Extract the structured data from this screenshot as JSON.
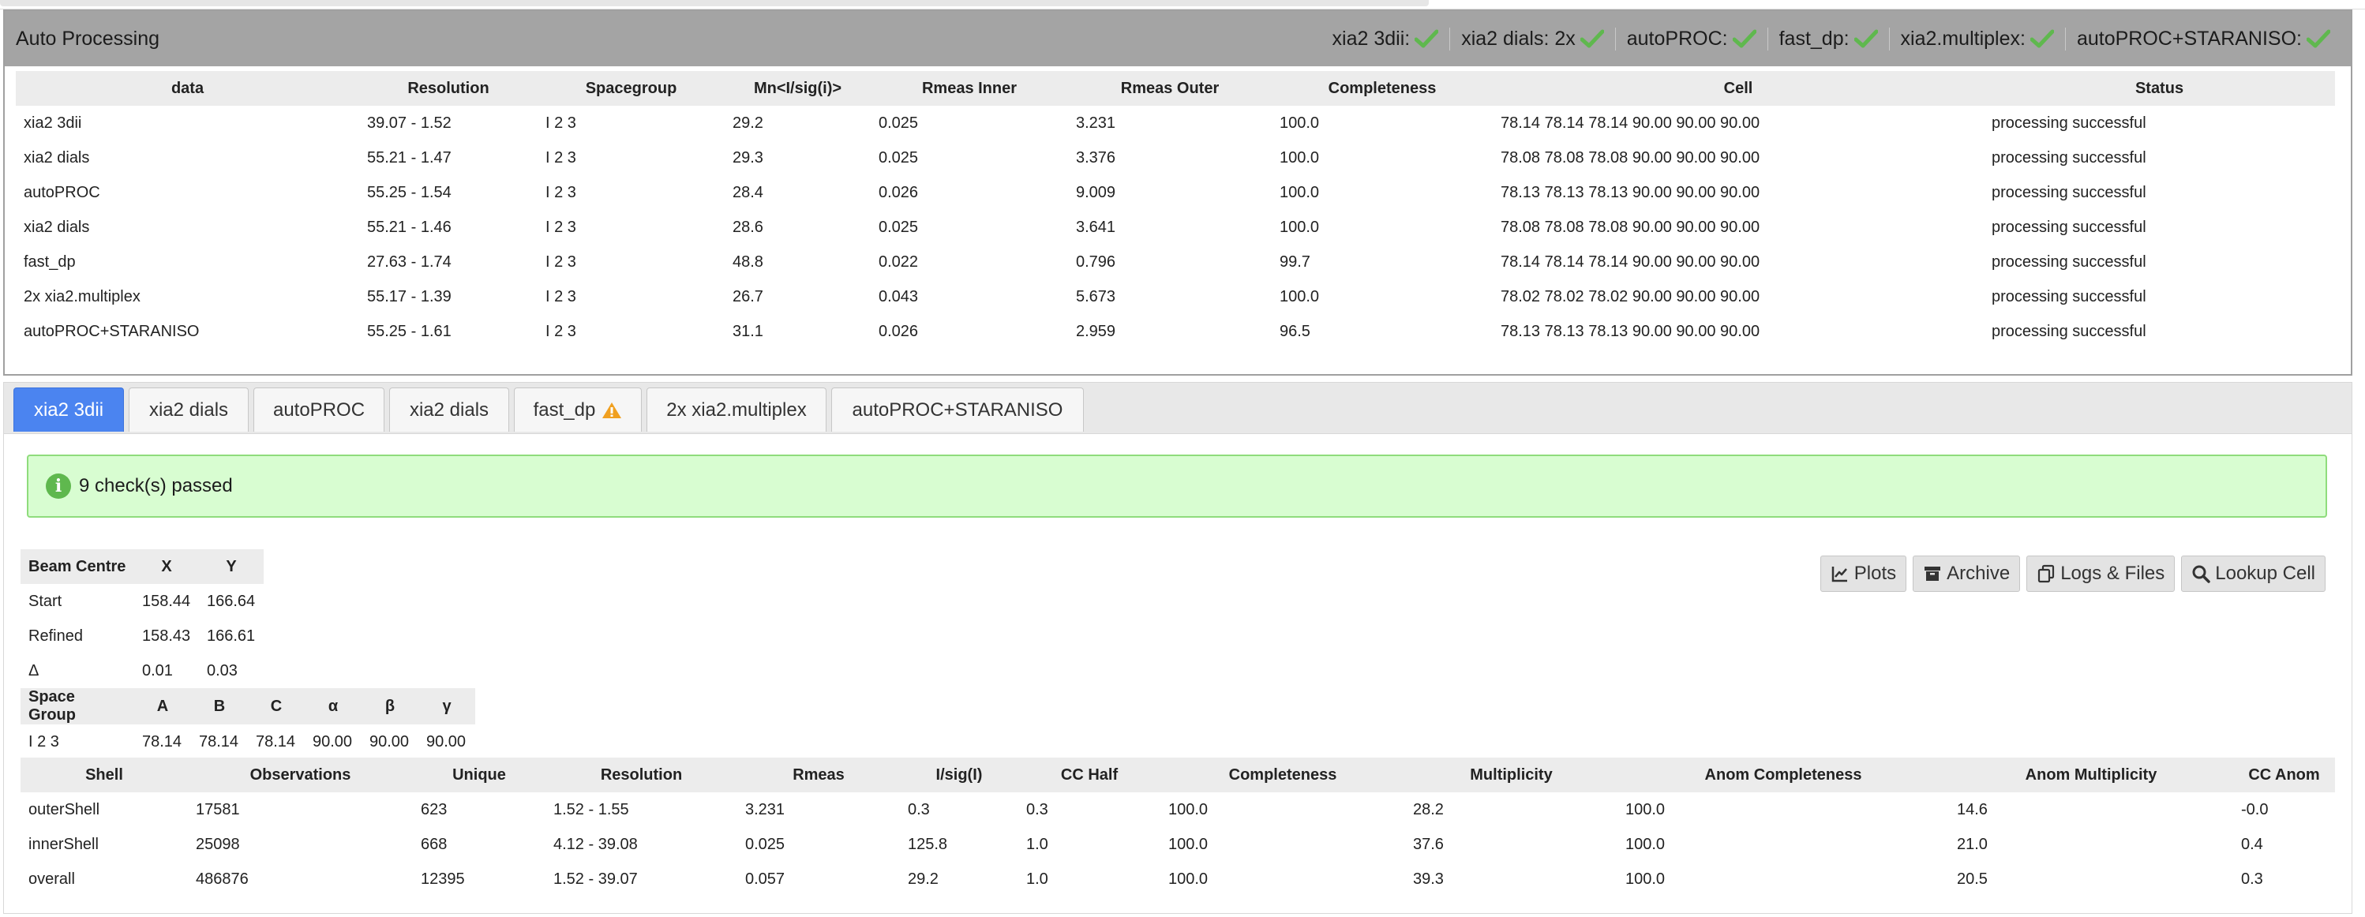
{
  "panel": {
    "title": "Auto Processing",
    "statuses": [
      "xia2 3dii:",
      "xia2 dials: 2x",
      "autoPROC:",
      "fast_dp:",
      "xia2.multiplex:",
      "autoPROC+STARANISO:"
    ]
  },
  "summary": {
    "columns": [
      "data",
      "Resolution",
      "Spacegroup",
      "Mn<I/sig(i)>",
      "Rmeas Inner",
      "Rmeas Outer",
      "Completeness",
      "Cell",
      "Status"
    ],
    "rows": [
      [
        "xia2 3dii",
        "39.07 - 1.52",
        "I 2 3",
        "29.2",
        "0.025",
        "3.231",
        "100.0",
        "78.14 78.14 78.14 90.00 90.00 90.00",
        "processing successful"
      ],
      [
        "xia2 dials",
        "55.21 - 1.47",
        "I 2 3",
        "29.3",
        "0.025",
        "3.376",
        "100.0",
        "78.08 78.08 78.08 90.00 90.00 90.00",
        "processing successful"
      ],
      [
        "autoPROC",
        "55.25 - 1.54",
        "I 2 3",
        "28.4",
        "0.026",
        "9.009",
        "100.0",
        "78.13 78.13 78.13 90.00 90.00 90.00",
        "processing successful"
      ],
      [
        "xia2 dials",
        "55.21 - 1.46",
        "I 2 3",
        "28.6",
        "0.025",
        "3.641",
        "100.0",
        "78.08 78.08 78.08 90.00 90.00 90.00",
        "processing successful"
      ],
      [
        "fast_dp",
        "27.63 - 1.74",
        "I 2 3",
        "48.8",
        "0.022",
        "0.796",
        "99.7",
        "78.14 78.14 78.14 90.00 90.00 90.00",
        "processing successful"
      ],
      [
        "2x xia2.multiplex",
        "55.17 - 1.39",
        "I 2 3",
        "26.7",
        "0.043",
        "5.673",
        "100.0",
        "78.02 78.02 78.02 90.00 90.00 90.00",
        "processing successful"
      ],
      [
        "autoPROC+STARANISO",
        "55.25 - 1.61",
        "I 2 3",
        "31.1",
        "0.026",
        "2.959",
        "96.5",
        "78.13 78.13 78.13 90.00 90.00 90.00",
        "processing successful"
      ]
    ]
  },
  "tabs": [
    "xia2 3dii",
    "xia2 dials",
    "autoPROC",
    "xia2 dials",
    "fast_dp",
    "2x xia2.multiplex",
    "autoPROC+STARANISO"
  ],
  "alert": {
    "icon": "i",
    "text": "9 check(s) passed"
  },
  "beam": {
    "columns": [
      "Beam Centre",
      "X",
      "Y"
    ],
    "rows": [
      [
        "Start",
        "158.44",
        "166.64"
      ],
      [
        "Refined",
        "158.43",
        "166.61"
      ],
      [
        "Δ",
        "0.01",
        "0.03"
      ]
    ]
  },
  "spacegroup": {
    "columns": [
      "Space Group",
      "A",
      "B",
      "C",
      "α",
      "β",
      "γ"
    ],
    "row": [
      "I 2 3",
      "78.14",
      "78.14",
      "78.14",
      "90.00",
      "90.00",
      "90.00"
    ]
  },
  "buttons": {
    "plots": "Plots",
    "archive": "Archive",
    "logs": "Logs & Files",
    "lookup": "Lookup Cell"
  },
  "shells": {
    "columns": [
      "Shell",
      "Observations",
      "Unique",
      "Resolution",
      "Rmeas",
      "I/sig(I)",
      "CC Half",
      "Completeness",
      "Multiplicity",
      "Anom Completeness",
      "Anom Multiplicity",
      "CC Anom"
    ],
    "rows": [
      [
        "outerShell",
        "17581",
        "623",
        "1.52 - 1.55",
        "3.231",
        "0.3",
        "0.3",
        "100.0",
        "28.2",
        "100.0",
        "14.6",
        "-0.0"
      ],
      [
        "innerShell",
        "25098",
        "668",
        "4.12 - 39.08",
        "0.025",
        "125.8",
        "1.0",
        "100.0",
        "37.6",
        "100.0",
        "21.0",
        "0.4"
      ],
      [
        "overall",
        "486876",
        "12395",
        "1.52 - 39.07",
        "0.057",
        "29.2",
        "1.0",
        "100.0",
        "39.3",
        "100.0",
        "20.5",
        "0.3"
      ]
    ]
  },
  "colors": {
    "accent": "#4b84f0",
    "success": "#5fb84e",
    "alert_bg": "#d8fdd1",
    "header_bg": "#a4a4a4",
    "warning": "#f0a020"
  }
}
